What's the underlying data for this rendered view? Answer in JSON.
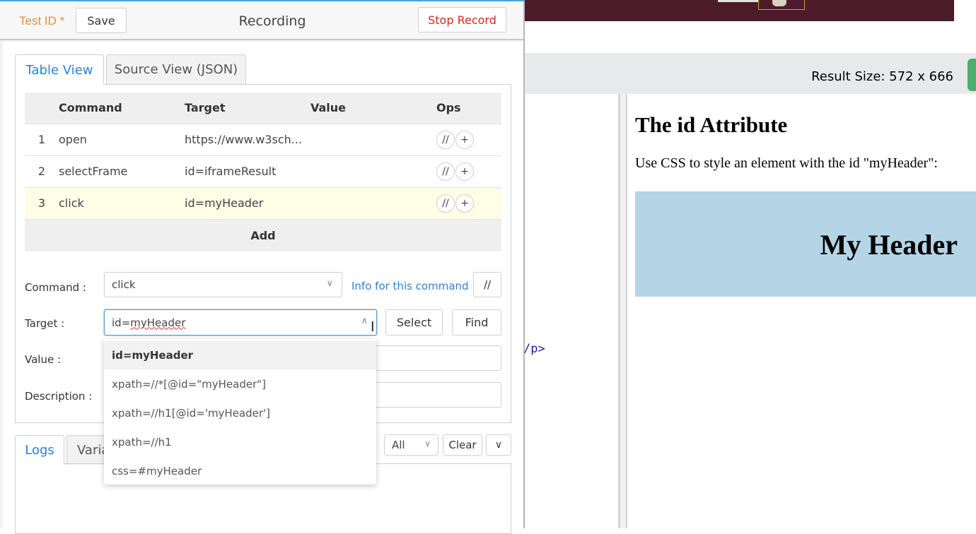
{
  "background_page": {
    "result_size": "Result Size: 572 x 666",
    "code_snippet": "/p>",
    "result_heading": "The id Attribute",
    "result_paragraph": "Use CSS to style an element with the id \"myHeader\":",
    "my_header_text": "My Header"
  },
  "header": {
    "test_id_label": "Test ID *",
    "save_label": "Save",
    "status": "Recording",
    "stop_label": "Stop Record"
  },
  "tabs": {
    "table_view": "Table View",
    "source_view": "Source View (JSON)"
  },
  "table": {
    "columns": [
      "",
      "Command",
      "Target",
      "Value",
      "Ops"
    ],
    "rows": [
      {
        "index": "1",
        "command": "open",
        "target": "https://www.w3sch...",
        "value": ""
      },
      {
        "index": "2",
        "command": "selectFrame",
        "target": "id=iframeResult",
        "value": ""
      },
      {
        "index": "3",
        "command": "click",
        "target": "id=myHeader",
        "value": ""
      }
    ],
    "ops_comment": "//",
    "ops_add": "+",
    "add_label": "Add"
  },
  "form": {
    "command_label": "Command :",
    "command_value": "click",
    "info_link": "Info for this command",
    "comment_toggle": "//",
    "target_label": "Target :",
    "target_prefix": "id=",
    "target_rest": "myHeader",
    "select_label": "Select",
    "find_label": "Find",
    "value_label": "Value :",
    "value_value": "",
    "description_label": "Description :",
    "description_value": ""
  },
  "target_suggestions": [
    "id=myHeader",
    "xpath=//*[@id=\"myHeader\"]",
    "xpath=//h1[@id='myHeader']",
    "xpath=//h1",
    "css=#myHeader"
  ],
  "logs": {
    "logs_tab": "Logs",
    "variables_tab": "Varia",
    "filter_value": "All",
    "clear_label": "Clear",
    "collapse_icon": "∨"
  },
  "colors": {
    "accent_blue": "#2f80d1",
    "stop_red": "#d02b1f",
    "test_id_orange": "#e08f3c",
    "selected_row": "#fefde5",
    "result_header_bg": "#b4d5e5"
  }
}
